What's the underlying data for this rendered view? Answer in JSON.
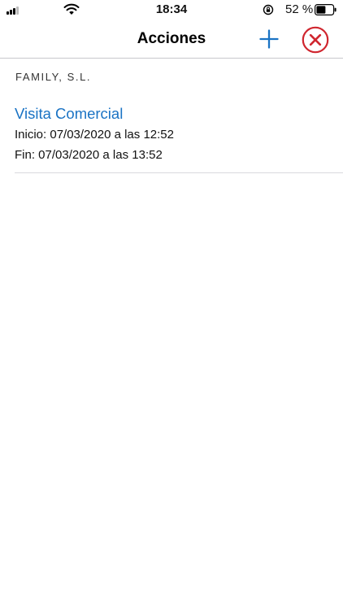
{
  "status_bar": {
    "time": "18:34",
    "battery_percent": "52 %"
  },
  "nav": {
    "title": "Acciones",
    "add_icon": "plus-icon",
    "close_icon": "close-circle-icon"
  },
  "colors": {
    "accent": "#1a73c4",
    "close": "#d0262f"
  },
  "section": {
    "header": "FAMILY, S.L."
  },
  "actions": [
    {
      "title": "Visita Comercial",
      "start": "Inicio: 07/03/2020 a las 12:52",
      "end": "Fin: 07/03/2020 a las 13:52"
    }
  ]
}
